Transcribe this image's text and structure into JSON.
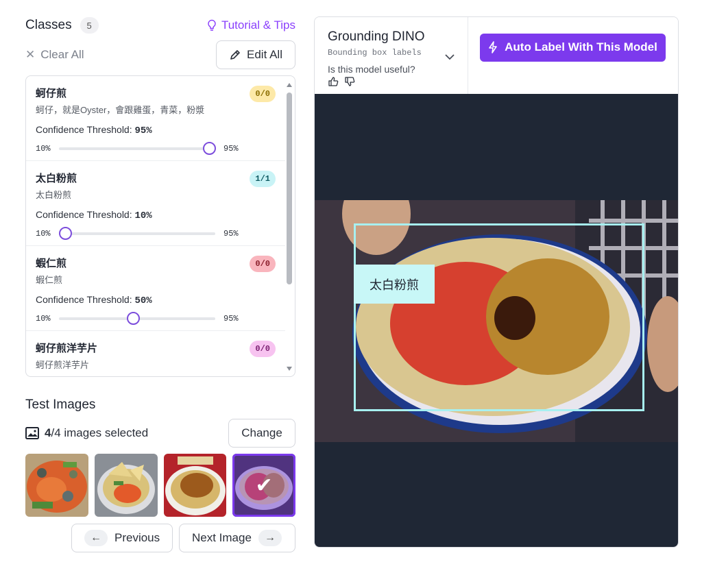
{
  "classes_panel": {
    "title": "Classes",
    "count": "5",
    "tutorial_label": "Tutorial & Tips",
    "clear_all_label": "Clear All",
    "edit_all_label": "Edit All"
  },
  "classes": [
    {
      "name": "蚵仔煎",
      "description": "蚵仔，就是Oyster，會跟雞蛋，青菜，粉漿",
      "badge": "0/0",
      "badge_bg": "#fde9a8",
      "badge_fg": "#8a6d00",
      "confidence_label": "Confidence Threshold:",
      "confidence": "95%",
      "slider_value": 95,
      "min": "10%",
      "max": "95%"
    },
    {
      "name": "太白粉煎",
      "description": "太白粉煎",
      "badge": "1/1",
      "badge_bg": "#c9f3f6",
      "badge_fg": "#0f5b63",
      "confidence_label": "Confidence Threshold:",
      "confidence": "10%",
      "slider_value": 10,
      "min": "10%",
      "max": "95%"
    },
    {
      "name": "蝦仁煎",
      "description": "蝦仁煎",
      "badge": "0/0",
      "badge_bg": "#f9b5bd",
      "badge_fg": "#8a1d2a",
      "confidence_label": "Confidence Threshold:",
      "confidence": "50%",
      "slider_value": 50,
      "min": "10%",
      "max": "95%"
    },
    {
      "name": "蚵仔煎洋芋片",
      "description": "蚵仔煎洋芋片",
      "badge": "0/0",
      "badge_bg": "#f7c3f0",
      "badge_fg": "#7a1d70"
    }
  ],
  "test_images": {
    "title": "Test Images",
    "selected_count": "4",
    "selected_total": "/4 images selected",
    "change_label": "Change",
    "previous_label": "Previous",
    "next_label": "Next Image"
  },
  "model": {
    "name": "Grounding DINO",
    "subtitle": "Bounding box labels",
    "question": "Is this model useful?",
    "auto_label": "Auto Label With This Model"
  },
  "detection": {
    "label": "太白粉煎"
  },
  "colors": {
    "accent": "#7c3aed",
    "canvas_bg": "#1f2735",
    "bbox": "#a7f0f0"
  }
}
